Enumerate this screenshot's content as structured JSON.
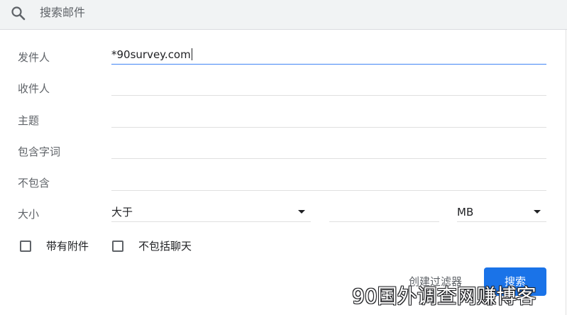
{
  "search": {
    "placeholder": "搜索邮件"
  },
  "form": {
    "from": {
      "label": "发件人",
      "value": "*90survey.com"
    },
    "to": {
      "label": "收件人",
      "value": ""
    },
    "subject": {
      "label": "主题",
      "value": ""
    },
    "has_words": {
      "label": "包含字词",
      "value": ""
    },
    "doesnt_have": {
      "label": "不包含",
      "value": ""
    },
    "size": {
      "label": "大小",
      "comparator": "大于",
      "amount": "",
      "unit": "MB"
    },
    "has_attachment": {
      "label": "带有附件",
      "checked": false
    },
    "exclude_chats": {
      "label": "不包括聊天",
      "checked": false
    }
  },
  "actions": {
    "create_filter": "创建过滤器",
    "search": "搜索"
  },
  "watermark": "90国外调查网赚博客",
  "icons": {
    "search": "search-icon",
    "dropdown": "caret-down-icon",
    "checkbox": "checkbox-unchecked-icon"
  },
  "colors": {
    "accent": "#1a73e8",
    "focus_underline": "#4285f4",
    "search_bar_bg": "#f1f3f4"
  }
}
